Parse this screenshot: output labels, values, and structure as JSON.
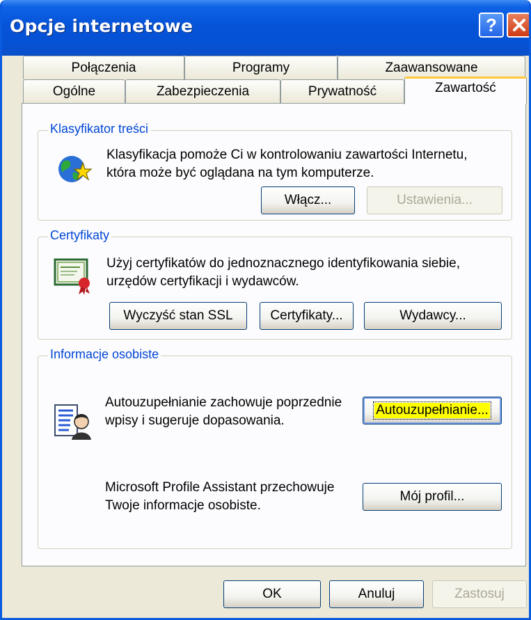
{
  "window": {
    "title": "Opcje internetowe",
    "help_glyph": "?",
    "help_icon": "help-icon",
    "close_icon": "close-icon"
  },
  "tabs": {
    "row_back": [
      "Połączenia",
      "Programy",
      "Zaawansowane"
    ],
    "row_front": [
      "Ogólne",
      "Zabezpieczenia",
      "Prywatność",
      "Zawartość"
    ],
    "active": "Zawartość"
  },
  "content_advisor": {
    "title": "Klasyfikator treści",
    "description_line1": "Klasyfikacja pomoże Ci w kontrolowaniu zawartości Internetu,",
    "description_line2": "która może być oglądana na tym komputerze.",
    "icon": "globe-star-icon",
    "enable_label": "Włącz...",
    "settings_label": "Ustawienia..."
  },
  "certificates": {
    "title": "Certyfikaty",
    "description_line1": "Użyj certyfikatów do jednoznacznego identyfikowania siebie,",
    "description_line2": "urzędów certyfikacji i wydawców.",
    "icon": "certificate-icon",
    "clear_ssl_label": "Wyczyść stan SSL",
    "certificates_label": "Certyfikaty...",
    "publishers_label": "Wydawcy..."
  },
  "personal_info": {
    "title": "Informacje osobiste",
    "autocomplete_line1": "Autouzupełnianie zachowuje poprzednie",
    "autocomplete_line2": "wpisy i sugeruje dopasowania.",
    "autocomplete_button": "Autouzupełnianie...",
    "profile_line1": "Microsoft Profile Assistant przechowuje",
    "profile_line2": "Twoje informacje osobiste.",
    "profile_button": "Mój profil...",
    "icon": "profile-card-icon"
  },
  "footer": {
    "ok_label": "OK",
    "cancel_label": "Anuluj",
    "apply_label": "Zastosuj"
  },
  "colors": {
    "titlebar": "#0653d8",
    "dialog_bg": "#ece9d8",
    "panel_bg": "#fcfcfe",
    "group_title": "#0046d5",
    "active_tab_accent": "#ffc83c",
    "focus_highlight": "#ffff00"
  }
}
